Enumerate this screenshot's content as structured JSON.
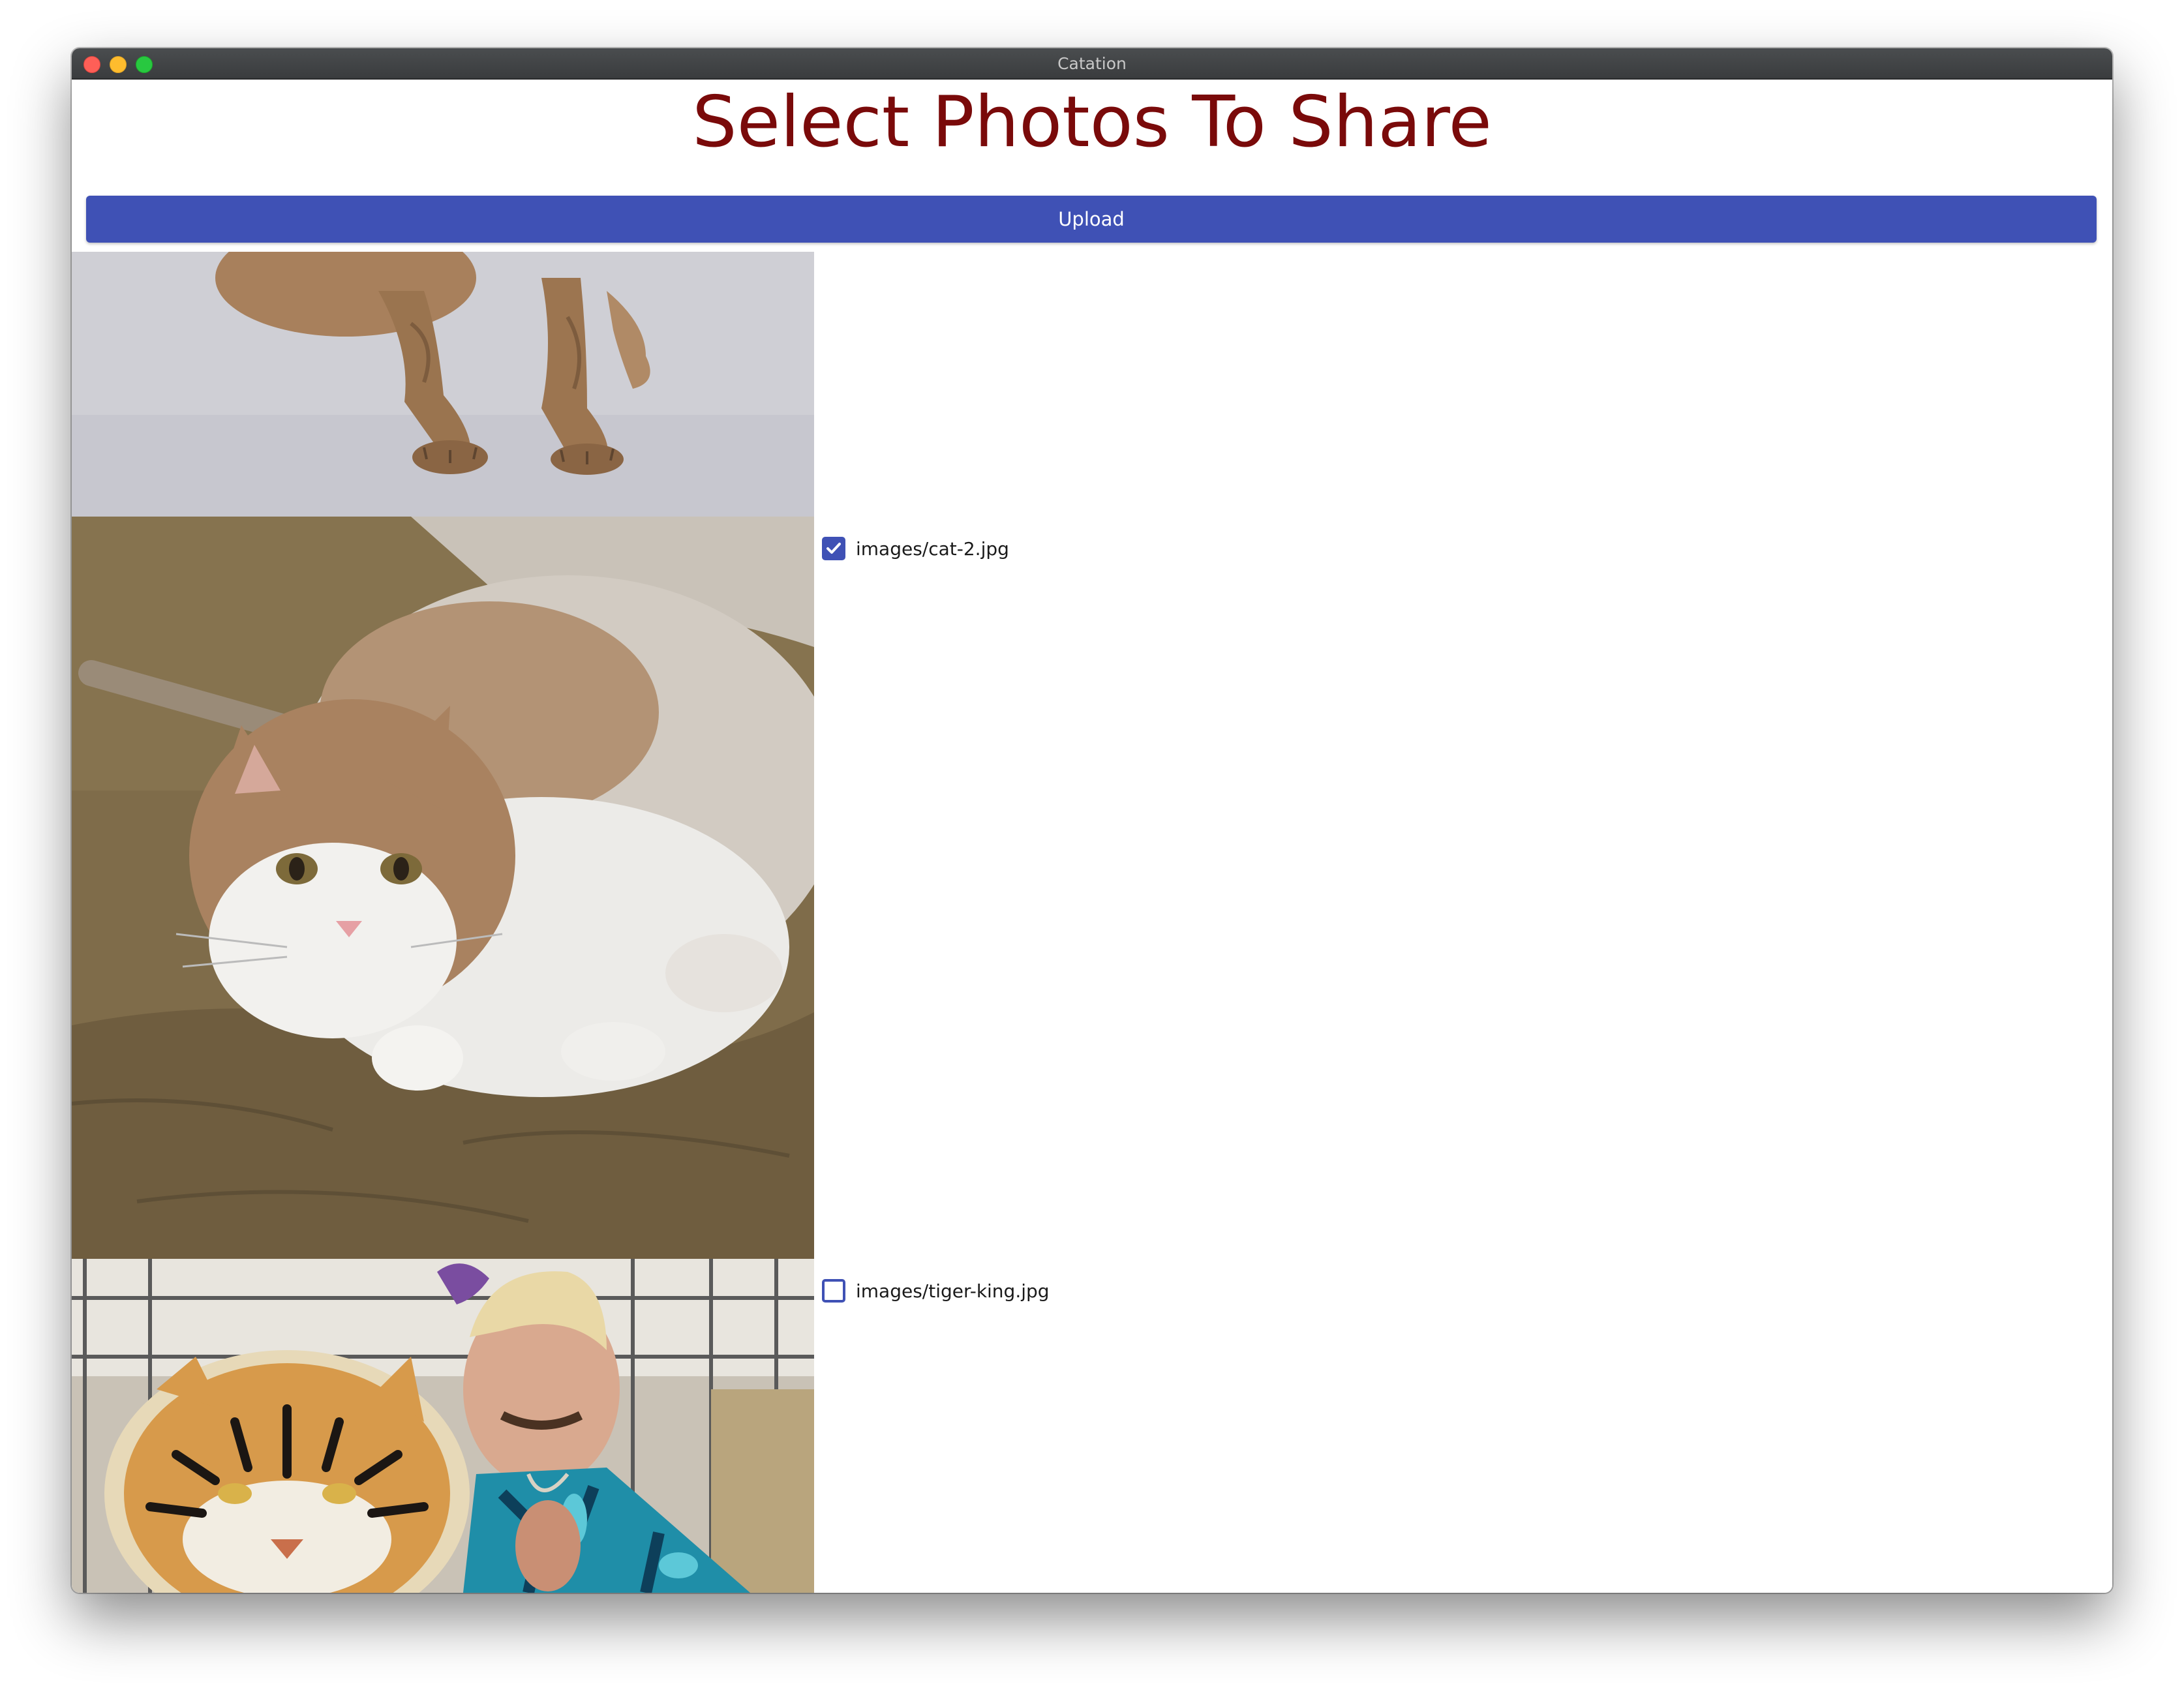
{
  "window": {
    "title": "Catation"
  },
  "page": {
    "title": "Select Photos To Share"
  },
  "toolbar": {
    "upload_label": "Upload"
  },
  "photos": [
    {
      "label": "",
      "checked": null
    },
    {
      "label": "images/cat-2.jpg",
      "checked": true
    },
    {
      "label": "images/tiger-king.jpg",
      "checked": false
    }
  ],
  "colors": {
    "title": "#7a0a0a",
    "accent": "#3f51b5",
    "titlebar": "#3e4042"
  }
}
